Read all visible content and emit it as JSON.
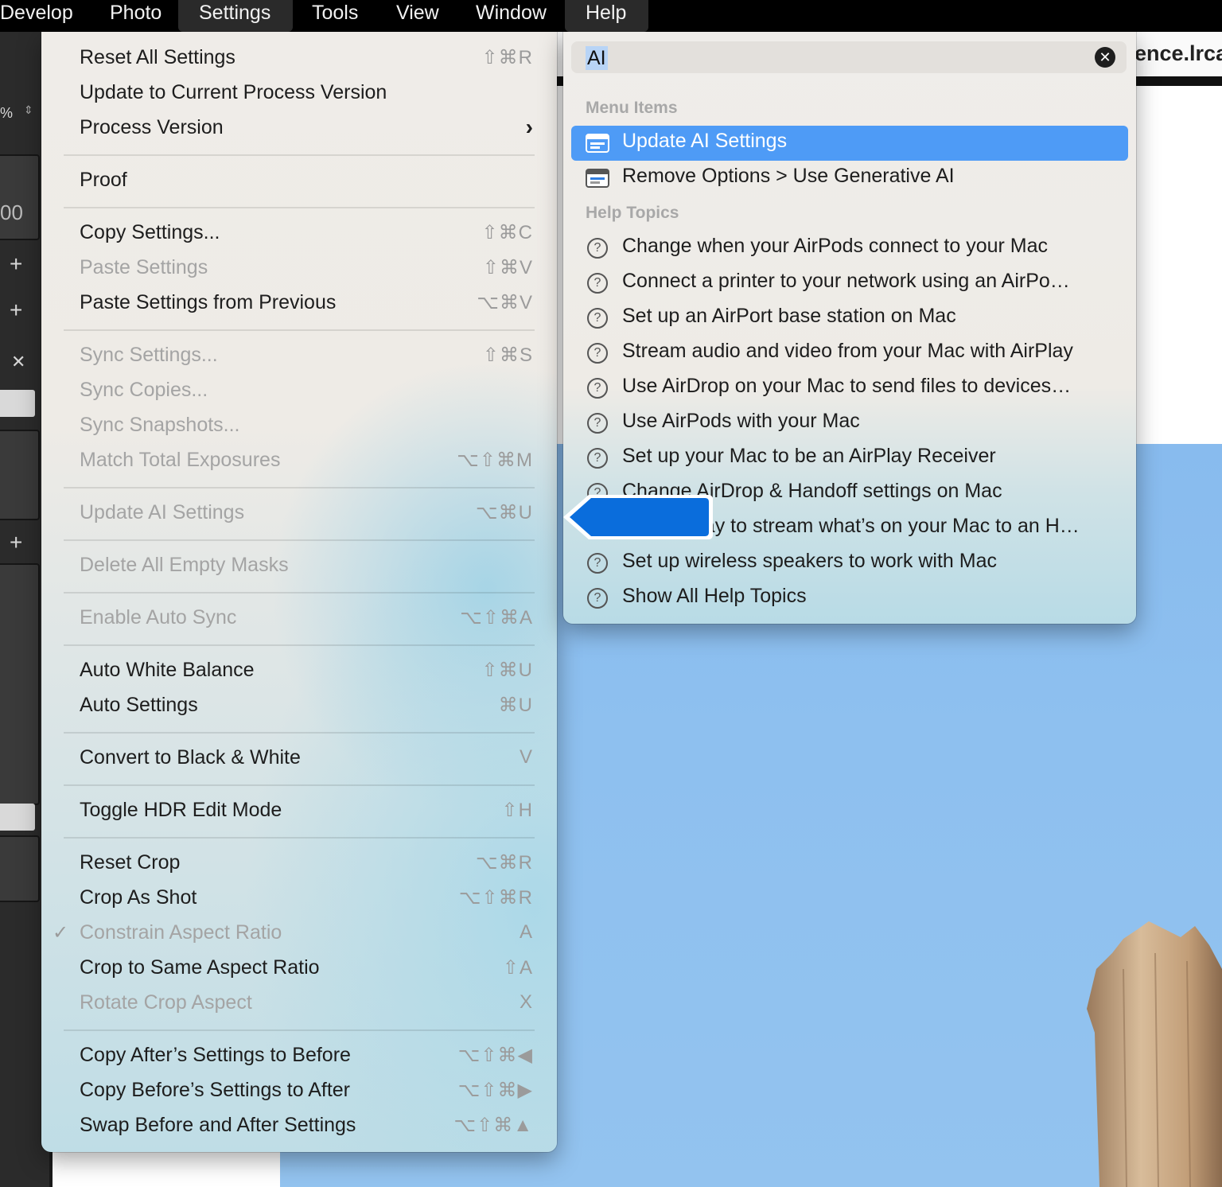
{
  "menubar": {
    "items": [
      {
        "label": "Develop",
        "active": false
      },
      {
        "label": "Photo",
        "active": false
      },
      {
        "label": "Settings",
        "active": true
      },
      {
        "label": "Tools",
        "active": false
      },
      {
        "label": "View",
        "active": false
      },
      {
        "label": "Window",
        "active": false
      },
      {
        "label": "Help",
        "active": true
      }
    ]
  },
  "background": {
    "url_fragment": "ence.lrca",
    "left_strip": {
      "percent_label": "%",
      "number_fragment": "00",
      "add_label": "+",
      "close_label": "✕"
    }
  },
  "settings_menu": {
    "items": [
      {
        "label": "Reset All Settings",
        "shortcut": "⇧⌘R",
        "enabled": true
      },
      {
        "label": "Update to Current Process Version",
        "shortcut": "",
        "enabled": true
      },
      {
        "label": "Process Version",
        "shortcut": "",
        "enabled": true,
        "submenu": true,
        "chevron": "›"
      },
      {
        "label": "Proof",
        "shortcut": "",
        "enabled": true
      },
      {
        "label": "Copy Settings...",
        "shortcut": "⇧⌘C",
        "enabled": true
      },
      {
        "label": "Paste Settings",
        "shortcut": "⇧⌘V",
        "enabled": false
      },
      {
        "label": "Paste Settings from Previous",
        "shortcut": "⌥⌘V",
        "enabled": true
      },
      {
        "label": "Sync Settings...",
        "shortcut": "⇧⌘S",
        "enabled": false
      },
      {
        "label": "Sync Copies...",
        "shortcut": "",
        "enabled": false
      },
      {
        "label": "Sync Snapshots...",
        "shortcut": "",
        "enabled": false
      },
      {
        "label": "Match Total Exposures",
        "shortcut": "⌥⇧⌘M",
        "enabled": false
      },
      {
        "label": "Update AI Settings",
        "shortcut": "⌥⌘U",
        "enabled": false
      },
      {
        "label": "Delete All Empty Masks",
        "shortcut": "",
        "enabled": false
      },
      {
        "label": "Enable Auto Sync",
        "shortcut": "⌥⇧⌘A",
        "enabled": false
      },
      {
        "label": "Auto White Balance",
        "shortcut": "⇧⌘U",
        "enabled": true
      },
      {
        "label": "Auto Settings",
        "shortcut": "⌘U",
        "enabled": true
      },
      {
        "label": "Convert to Black & White",
        "shortcut": "V",
        "enabled": true
      },
      {
        "label": "Toggle HDR Edit Mode",
        "shortcut": "⇧H",
        "enabled": true
      },
      {
        "label": "Reset Crop",
        "shortcut": "⌥⌘R",
        "enabled": true
      },
      {
        "label": "Crop As Shot",
        "shortcut": "⌥⇧⌘R",
        "enabled": true
      },
      {
        "label": "Constrain Aspect Ratio",
        "shortcut": "A",
        "enabled": false,
        "checked": true,
        "check_mark": "✓"
      },
      {
        "label": "Crop to Same Aspect Ratio",
        "shortcut": "⇧A",
        "enabled": true
      },
      {
        "label": "Rotate Crop Aspect",
        "shortcut": "X",
        "enabled": false
      },
      {
        "label": "Copy After’s Settings to Before",
        "shortcut": "⌥⇧⌘◀",
        "enabled": true
      },
      {
        "label": "Copy Before’s Settings to After",
        "shortcut": "⌥⇧⌘▶",
        "enabled": true
      },
      {
        "label": "Swap Before and After Settings",
        "shortcut": "⌥⇧⌘▲",
        "enabled": true
      }
    ]
  },
  "help_menu": {
    "search": {
      "query": "AI",
      "clear_label": "✕"
    },
    "sections": {
      "menu_items": "Menu Items",
      "help_topics": "Help Topics"
    },
    "menu_items": [
      {
        "label": "Update AI Settings",
        "selected": true,
        "icon": "menu-item-icon"
      },
      {
        "label": "Remove Options > Use Generative AI",
        "selected": false,
        "icon": "menu-item-icon"
      }
    ],
    "help_topics": [
      {
        "label": "Change when your AirPods connect to your Mac",
        "icon_glyph": "?"
      },
      {
        "label": "Connect a printer to your network using an AirPo…",
        "icon_glyph": "?"
      },
      {
        "label": "Set up an AirPort base station on Mac",
        "icon_glyph": "?"
      },
      {
        "label": "Stream audio and video from your Mac with AirPlay",
        "icon_glyph": "?"
      },
      {
        "label": "Use AirDrop on your Mac to send files to devices…",
        "icon_glyph": "?"
      },
      {
        "label": "Use AirPods with your Mac",
        "icon_glyph": "?"
      },
      {
        "label": "Set up your Mac to be an AirPlay Receiver",
        "icon_glyph": "?"
      },
      {
        "label": "Change AirDrop & Handoff settings on Mac",
        "icon_glyph": "?"
      },
      {
        "label": "Use AirPlay to stream what’s on your Mac to an H…",
        "icon_glyph": "?"
      },
      {
        "label": "Set up wireless speakers to work with Mac",
        "icon_glyph": "?"
      },
      {
        "label": "Show All Help Topics",
        "icon_glyph": "?"
      }
    ]
  },
  "colors": {
    "selection_blue": "#4e9bf6",
    "pointer_blue": "#0a6ddc",
    "sky": "#8ec0ef"
  }
}
